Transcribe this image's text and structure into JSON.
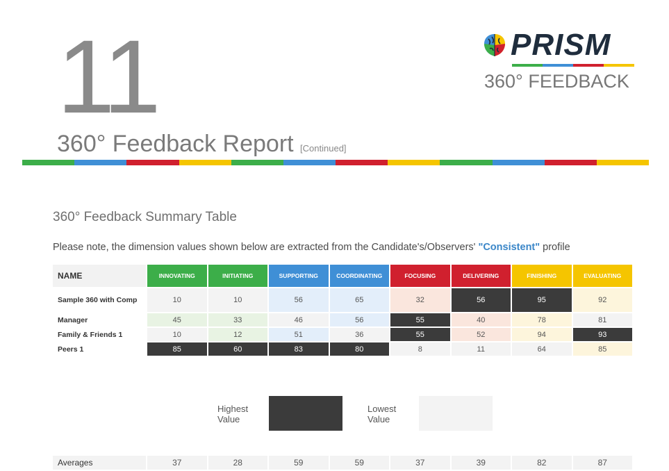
{
  "header": {
    "page_number": "11",
    "report_title": "360° Feedback Report",
    "continued": "[Continued]",
    "logo_word": "PRISM",
    "logo_sub": "360° FEEDBACK"
  },
  "colors": {
    "green": "#3cae49",
    "blue": "#3f8fd6",
    "red": "#d0202e",
    "yellow": "#f5c500",
    "dark": "#3b3b3b",
    "light": "#f3f3f3"
  },
  "summary": {
    "title": "360° Feedback Summary Table",
    "note_prefix": "Please note, the dimension values shown below are extracted from the Candidate's/Observers' ",
    "note_highlight": "\"Consistent\"",
    "note_suffix": " profile"
  },
  "table": {
    "name_header": "NAME",
    "columns": [
      "INNOVATING",
      "INITIATING",
      "SUPPORTING",
      "COORDINATING",
      "FOCUSING",
      "DELIVERING",
      "FINISHING",
      "EVALUATING"
    ],
    "column_colors": [
      "green",
      "green",
      "blue",
      "blue",
      "red",
      "red",
      "yellow",
      "yellow"
    ],
    "rows": [
      {
        "name": "Sample 360 with Comp",
        "values": [
          "10",
          "10",
          "56",
          "65",
          "32",
          "56",
          "95",
          "92"
        ],
        "shades": [
          "white",
          "white",
          "blue",
          "blue",
          "red",
          "dark",
          "dark",
          "yellow"
        ]
      },
      {
        "name": "Manager",
        "values": [
          "45",
          "33",
          "46",
          "56",
          "55",
          "40",
          "78",
          "81"
        ],
        "shades": [
          "green",
          "green",
          "white",
          "blue",
          "dark",
          "red",
          "yellow",
          "white"
        ]
      },
      {
        "name": "Family & Friends 1",
        "values": [
          "10",
          "12",
          "51",
          "36",
          "55",
          "52",
          "94",
          "93"
        ],
        "shades": [
          "white",
          "green",
          "blue",
          "white",
          "dark",
          "red",
          "yellow",
          "dark"
        ]
      },
      {
        "name": "Peers 1",
        "values": [
          "85",
          "60",
          "83",
          "80",
          "8",
          "11",
          "64",
          "85"
        ],
        "shades": [
          "dark",
          "dark",
          "dark",
          "dark",
          "white",
          "white",
          "white",
          "yellow"
        ]
      }
    ]
  },
  "legend": {
    "highest_label": "Highest Value",
    "lowest_label": "Lowest Value"
  },
  "averages": {
    "label": "Averages",
    "values": [
      "37",
      "28",
      "59",
      "59",
      "37",
      "39",
      "82",
      "87"
    ]
  }
}
